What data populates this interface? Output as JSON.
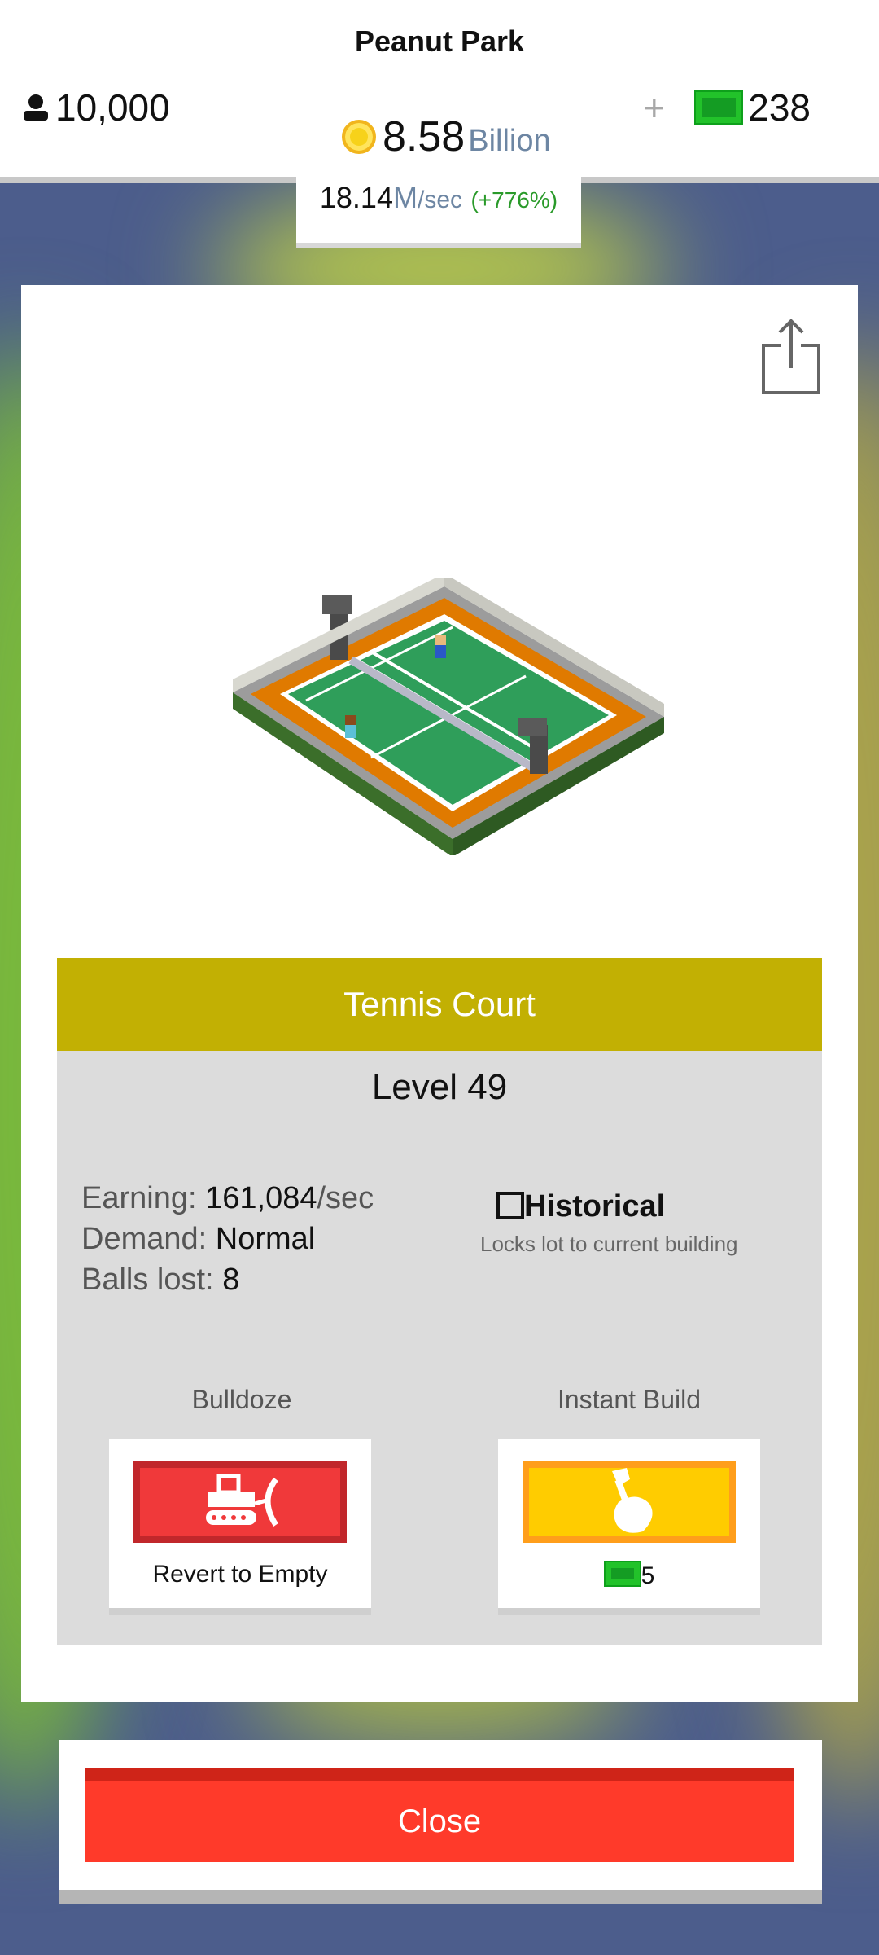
{
  "header": {
    "park_name": "Peanut Park",
    "population": "10,000",
    "money_value": "8.58",
    "money_unit": "Billion",
    "cash_plus": "+",
    "cash_value": "238",
    "rate_value": "18.14",
    "rate_unit_m": "M",
    "rate_unit_sec": "/sec",
    "rate_percent": "(+776%)"
  },
  "building": {
    "name": "Tennis Court",
    "level": "Level 49",
    "stats": [
      {
        "label": "Earning:",
        "value": "161,084",
        "suffix": "/sec"
      },
      {
        "label": "Demand:",
        "value": "Normal",
        "suffix": ""
      },
      {
        "label": "Balls lost:",
        "value": "8",
        "suffix": ""
      }
    ],
    "historical_label": "Historical",
    "historical_note": "Locks lot to current building",
    "historical_checked": false
  },
  "actions": {
    "bulldoze_label": "Bulldoze",
    "bulldoze_caption": "Revert to Empty",
    "instant_label": "Instant Build",
    "instant_cost": "5"
  },
  "close_label": "Close",
  "colors": {
    "name_band": "#c2b003",
    "bulldoze": "#f0393a",
    "instant": "#ffcc00",
    "close": "#ff3a2a",
    "cash_green": "#22c22a"
  },
  "icons": [
    "person-icon",
    "coin-icon",
    "cash-icon",
    "share-icon",
    "bulldozer-icon",
    "hammer-hand-icon"
  ]
}
